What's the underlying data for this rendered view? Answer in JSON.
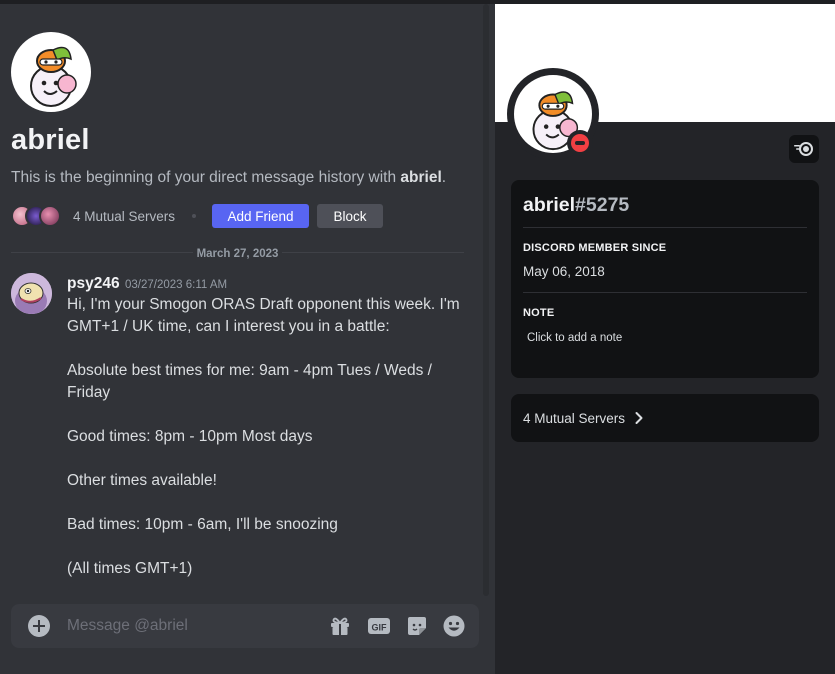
{
  "dm": {
    "name": "abriel",
    "intro_prefix": "This is the beginning of your direct message history with ",
    "intro_name": "abriel",
    "intro_suffix": ".",
    "mutual_servers": "4 Mutual Servers",
    "add_friend": "Add Friend",
    "block": "Block"
  },
  "divider_date": "March 27, 2023",
  "message": {
    "author": "psy246",
    "timestamp": "03/27/2023 6:11 AM",
    "lines": [
      "Hi, I'm your Smogon ORAS Draft opponent this week. I'm GMT+1 / UK time, can I interest you in a battle:",
      "",
      "Absolute best times for me: 9am - 4pm Tues / Weds / Friday",
      "",
      "Good times: 8pm - 10pm Most days",
      "",
      "Other times available!",
      "",
      "Bad times: 10pm - 6am, I'll be snoozing",
      "",
      "(All times GMT+1)"
    ]
  },
  "composer": {
    "placeholder": "Message @abriel"
  },
  "profile": {
    "username": "abriel",
    "discriminator": "#5275",
    "member_since_label": "DISCORD MEMBER SINCE",
    "member_since": "May 06, 2018",
    "note_label": "NOTE",
    "note_placeholder": "Click to add a note",
    "mutual_servers": "4 Mutual Servers",
    "status": "do-not-disturb"
  },
  "colors": {
    "blurple": "#5865f2",
    "dnd_red": "#f23f43",
    "chat_bg": "#313338",
    "profile_bg": "#232428",
    "card_bg": "#111214"
  },
  "icons": [
    "plus-circle-icon",
    "gift-icon",
    "gif-icon",
    "sticker-icon",
    "emoji-icon",
    "chevron-right-icon",
    "nitro-badge-icon"
  ]
}
